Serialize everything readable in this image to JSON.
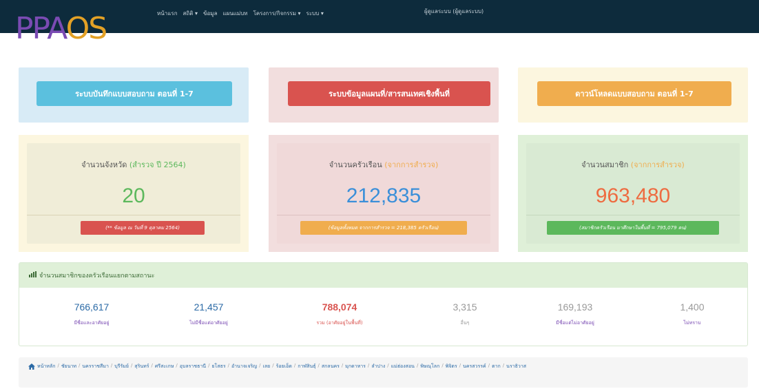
{
  "brand": {
    "logo_text_a": "PPA",
    "logo_text_b": "OS"
  },
  "nav": {
    "items": [
      "หน้าแรก",
      "สถิติ ▾",
      "ข้อมูล",
      "แผนแม่บท",
      "โครงการ/กิจกรรม ▾",
      "ระบบ ▾"
    ],
    "user_label": "ผู้ดูแลระบบ (ผู้ดูแลระบบ)"
  },
  "panels": [
    {
      "label": "ระบบบันทึกแบบสอบถาม ตอนที่ 1-7",
      "bg": "#d8ebf6",
      "btn": "#5bc0de"
    },
    {
      "label": "ระบบข้อมูลแผนที่/สารสนเทศเชิงพื้นที่",
      "bg": "#f2dede",
      "btn": "#d9534f"
    },
    {
      "label": "ดาวน์โหลดแบบสอบถาม ตอนที่ 1-7",
      "bg": "#fcf6df",
      "btn": "#f0ad4e"
    }
  ],
  "stats": [
    {
      "title": "จำนวนจังหวัด",
      "title_note": "(สำรวจ ปี 2564)",
      "value": "20",
      "badge": "(** ข้อมูล ณ วันที่ 9 ตุลาคม 2564)",
      "value_color": "#5cb85c",
      "note_color": "#5cb85c",
      "badge_color": "#d9534f",
      "outer": "#fcf6df",
      "inner": "#f0edd8"
    },
    {
      "title": "จำนวนครัวเรือน",
      "title_note": "(จากการสำรวจ)",
      "value": "212,835",
      "badge": "(ข้อมูลทั้งหมด จากการสำรวจ = 218,385 ครัวเรือน)",
      "value_color": "#3a8fd9",
      "note_color": "#f0ad4e",
      "badge_color": "#f0ad4e",
      "outer": "#f2dede",
      "inner": "#f0d9d9"
    },
    {
      "title": "จำนวนสมาชิก",
      "title_note": "(จากการสำรวจ)",
      "value": "963,480",
      "badge": "(สมาชิกครัวเรือน มาศึกษาในพื้นที่ = 795,079 คน)",
      "value_color": "#ee6b40",
      "note_color": "#f0ad4e",
      "badge_color": "#5cb85c",
      "outer": "#dff0d8",
      "inner": "#d9ead3"
    }
  ],
  "members": {
    "heading": "จำนวนสมาชิกของครัวเรือนแยกตามสถานะ",
    "cols": [
      {
        "value": "766,617",
        "label": "มีชื่อและอาศัยอยู่",
        "value_color": "#2b6aa6",
        "label_color": "#7a4bb3"
      },
      {
        "value": "21,457",
        "label": "ไม่มีชื่อแต่อาศัยอยู่",
        "value_color": "#2b6aa6",
        "label_color": "#7a4bb3"
      },
      {
        "value": "788,074",
        "label": "รวม (อาศัยอยู่ในพื้นที่)",
        "value_color": "#d9534f",
        "label_color": "#d9534f"
      },
      {
        "value": "3,315",
        "label": "อื่นๆ",
        "value_color": "#999999",
        "label_color": "#999999"
      },
      {
        "value": "169,193",
        "label": "มีชื่อแต่ไม่อาศัยอยู่",
        "value_color": "#999999",
        "label_color": "#7a4bb3"
      },
      {
        "value": "1,400",
        "label": "ไม่ทราบ",
        "value_color": "#999999",
        "label_color": "#7a4bb3"
      }
    ]
  },
  "breadcrumb": [
    "หน้าหลัก",
    "ชัยนาท",
    "นครราชสีมา",
    "บุรีรัมย์",
    "สุรินทร์",
    "ศรีสะเกษ",
    "อุบลราชธานี",
    "ยโสธร",
    "อำนาจเจริญ",
    "เลย",
    "ร้อยเอ็ด",
    "กาฬสินธุ์",
    "สกลนคร",
    "มุกดาหาร",
    "ลำปาง",
    "แม่ฮ่องสอน",
    "พิษณุโลก",
    "พิจิตร",
    "นครสวรรค์",
    "ตาก",
    "นราธิวาส"
  ],
  "icons": {
    "home": "home-icon",
    "chart": "bar-chart-icon"
  }
}
